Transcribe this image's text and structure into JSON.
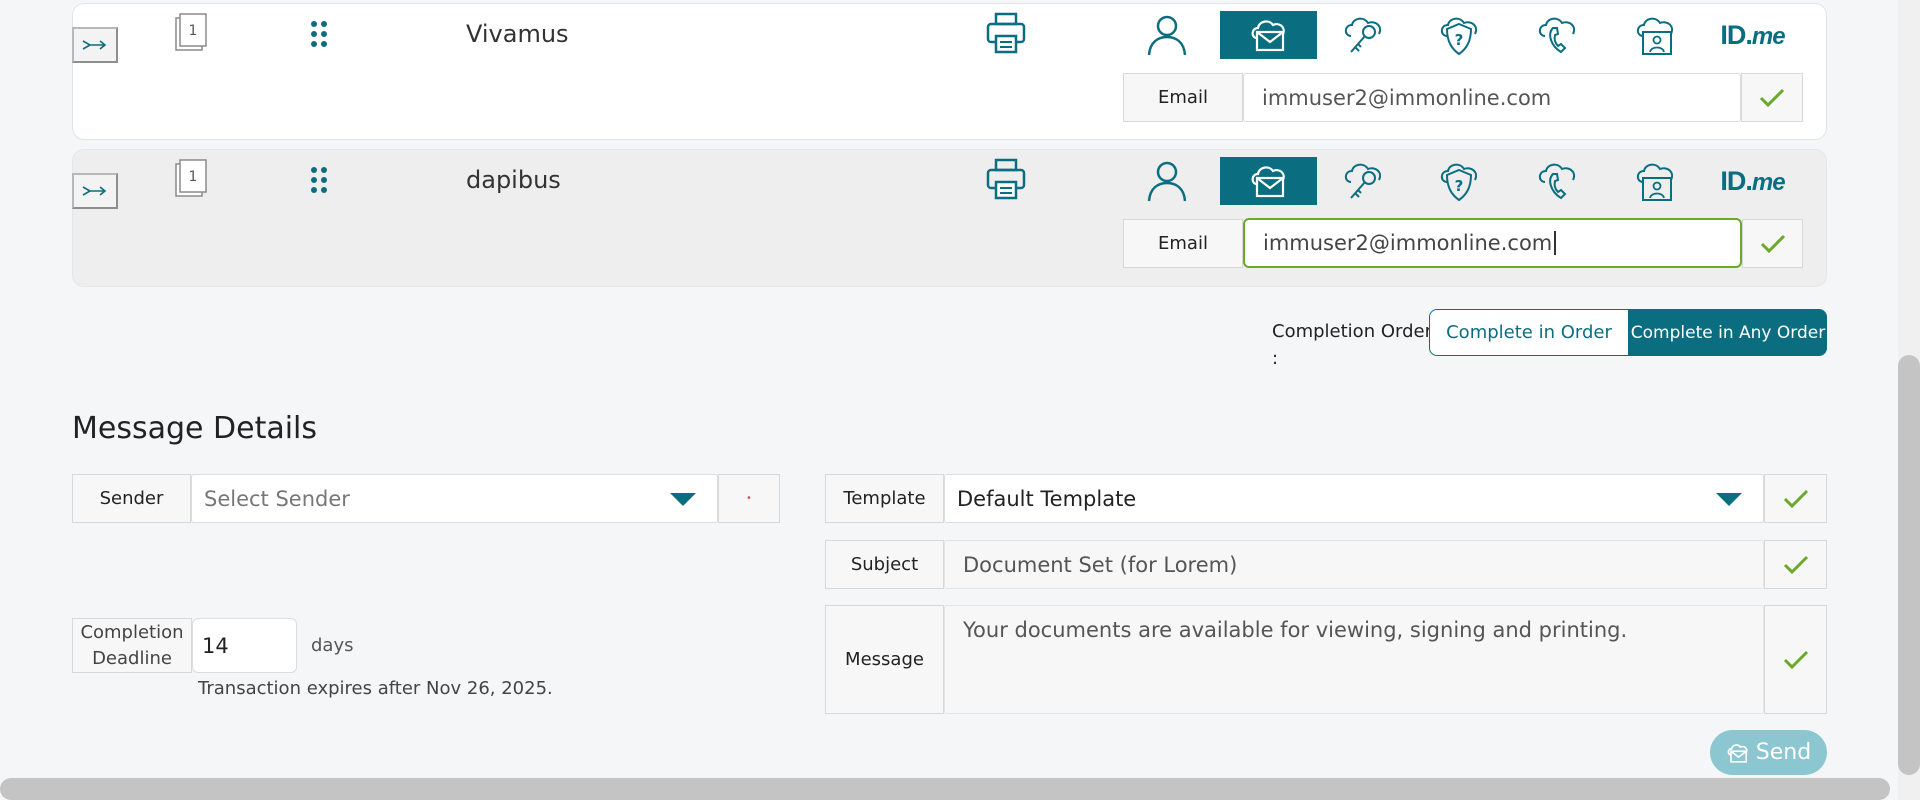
{
  "signers": [
    {
      "name": "Vivamus",
      "doc_number": "1",
      "delivery_label": "Email",
      "delivery_value": "immuser2@immonline.com",
      "focused": false
    },
    {
      "name": "dapibus",
      "doc_number": "1",
      "delivery_label": "Email",
      "delivery_value": "immuser2@immonline.com",
      "focused": true
    }
  ],
  "auth_icons": [
    "person-icon",
    "email-cloud-icon",
    "cloud-key-icon",
    "shield-question-icon",
    "cloud-phone-icon",
    "cloud-id-card-icon",
    "idme-logo"
  ],
  "idme": {
    "main": "ID.",
    "italic": "me"
  },
  "completion_order": {
    "label": "Completion Order",
    "colon": ":",
    "options": [
      "Complete in Order",
      "Complete in Any Order"
    ],
    "selected": "Complete in Any Order"
  },
  "message_details": {
    "heading": "Message Details",
    "sender_label": "Sender",
    "sender_placeholder": "Select Sender",
    "required_mark": "•",
    "template_label": "Template",
    "template_value": "Default Template",
    "subject_label": "Subject",
    "subject_value": "Document Set (for Lorem)",
    "message_label": "Message",
    "message_value": "Your documents are available for viewing, signing and printing.",
    "deadline_label_1": "Completion",
    "deadline_label_2": "Deadline",
    "deadline_value": "14",
    "deadline_unit": "days",
    "expires_text": "Transaction expires after Nov 26, 2025."
  },
  "send_label": "Send",
  "colors": {
    "primary": "#0b6e80",
    "success": "#6aa92a",
    "send_disabled": "#8cc6d1"
  }
}
